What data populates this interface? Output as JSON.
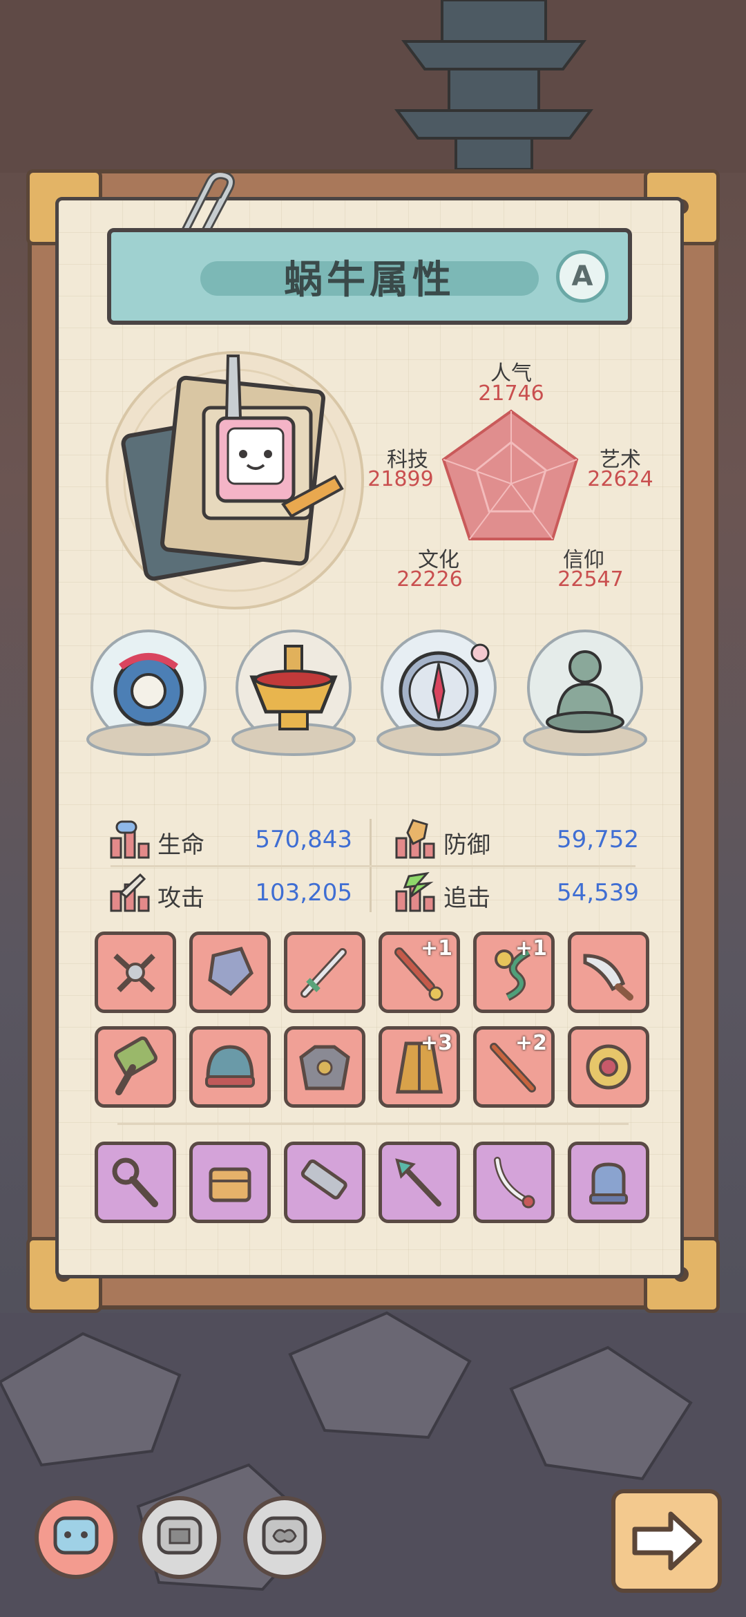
{
  "title": "蜗牛属性",
  "grade": "A",
  "radar": {
    "popularity": {
      "label": "人气",
      "value": "21746"
    },
    "art": {
      "label": "艺术",
      "value": "22624"
    },
    "faith": {
      "label": "信仰",
      "value": "22547"
    },
    "culture": {
      "label": "文化",
      "value": "22226"
    },
    "tech": {
      "label": "科技",
      "value": "21899"
    }
  },
  "relics": [
    {
      "icon": "sea-monster-relic-icon"
    },
    {
      "icon": "hotpot-relic-icon"
    },
    {
      "icon": "compass-relic-icon"
    },
    {
      "icon": "buddha-statue-relic-icon"
    }
  ],
  "stats": {
    "hp": {
      "label": "生命",
      "value": "570,843"
    },
    "defense": {
      "label": "防御",
      "value": "59,752"
    },
    "attack": {
      "label": "攻击",
      "value": "103,205"
    },
    "chase": {
      "label": "追击",
      "value": "54,539"
    }
  },
  "equipment_red": [
    {
      "icon": "scale-weapon-icon",
      "plus": ""
    },
    {
      "icon": "crystal-shield-icon",
      "plus": ""
    },
    {
      "icon": "sword-icon",
      "plus": ""
    },
    {
      "icon": "dagger-icon",
      "plus": "+1"
    },
    {
      "icon": "serpent-staff-icon",
      "plus": "+1"
    },
    {
      "icon": "knife-icon",
      "plus": ""
    },
    {
      "icon": "hammer-icon",
      "plus": ""
    },
    {
      "icon": "helmet-icon",
      "plus": ""
    },
    {
      "icon": "armor-icon",
      "plus": ""
    },
    {
      "icon": "robe-icon",
      "plus": "+3"
    },
    {
      "icon": "spear-icon",
      "plus": "+2"
    },
    {
      "icon": "amulet-icon",
      "plus": ""
    }
  ],
  "equipment_purple": [
    {
      "icon": "scepter-icon"
    },
    {
      "icon": "chest-icon"
    },
    {
      "icon": "blaster-icon"
    },
    {
      "icon": "arrow-icon"
    },
    {
      "icon": "sabre-icon"
    },
    {
      "icon": "gauntlet-icon"
    }
  ],
  "bottom_tabs": [
    {
      "icon": "snail-face-blue-icon",
      "active": true
    },
    {
      "icon": "snail-face-gray-icon",
      "active": false
    },
    {
      "icon": "snail-brain-gray-icon",
      "active": false
    }
  ],
  "next_button": {
    "icon": "arrow-right-icon"
  },
  "colors": {
    "paper": "#f2e9d6",
    "banner": "#9fd1d0",
    "stat_value": "#3f6ed3",
    "radar_value": "#c94f4f",
    "slot_red": "#f0a096",
    "slot_purple": "#d4a3d9"
  }
}
